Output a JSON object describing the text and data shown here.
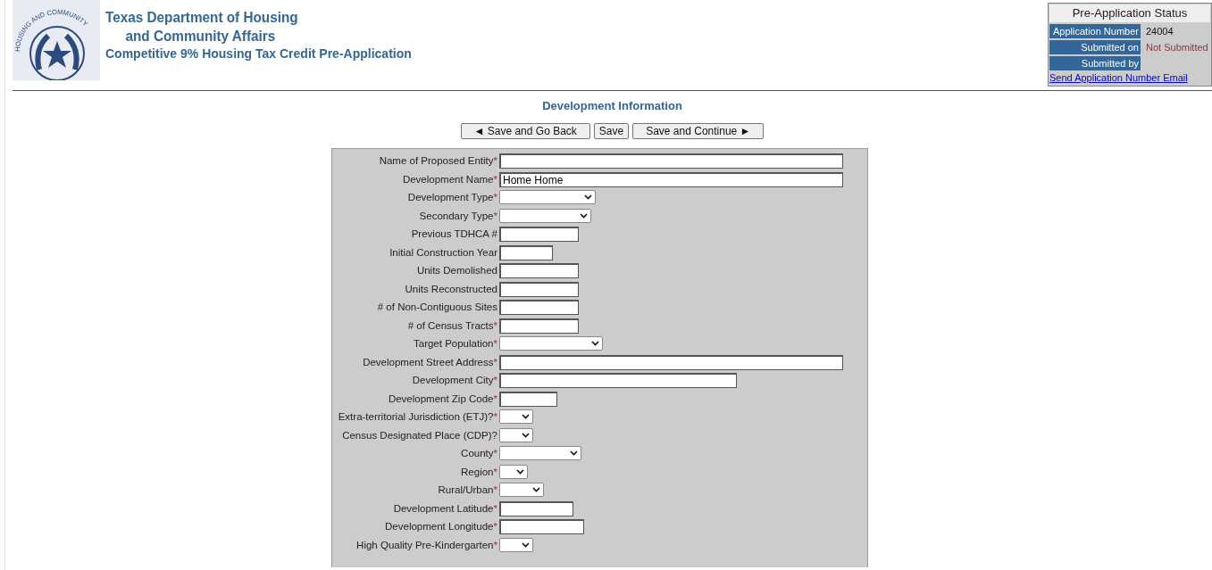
{
  "header": {
    "seal_text": "HOUSING AND COMMUNITY",
    "agency_line_1": "Texas Department of Housing",
    "agency_line_2": "and Community Affairs",
    "subtitle": "Competitive 9% Housing Tax Credit Pre-Application"
  },
  "status_panel": {
    "title": "Pre-Application Status",
    "rows": [
      {
        "label": "Application Number",
        "value": "24004",
        "kind": "plain"
      },
      {
        "label": "Submitted on",
        "value": "Not Submitted",
        "kind": "alert"
      },
      {
        "label": "Submitted by",
        "kind": "plain"
      }
    ],
    "link": "Send Application Number Email"
  },
  "section_title": "Development Information",
  "buttons": [
    {
      "label": "Save and Go Back",
      "arrow_before": "◄"
    },
    {
      "label": "Save"
    },
    {
      "label": "Save and Continue",
      "arrow_after": "►"
    }
  ],
  "fields": [
    {
      "label": "Name of Proposed Entity",
      "required": "*",
      "kind": "text"
    },
    {
      "label": "Development Name",
      "required": "*",
      "kind": "text",
      "value": "Home Home"
    },
    {
      "label": "Development Type",
      "required": "*",
      "kind": "select"
    },
    {
      "label": "Secondary Type",
      "required": "*",
      "kind": "select"
    },
    {
      "label": "Previous TDHCA #",
      "kind": "text"
    },
    {
      "label": "Initial Construction Year",
      "kind": "text"
    },
    {
      "label": "Units Demolished",
      "kind": "text"
    },
    {
      "label": "Units Reconstructed",
      "kind": "text"
    },
    {
      "label": "# of Non-Contiguous Sites",
      "kind": "text"
    },
    {
      "label": "# of Census Tracts",
      "required": "*",
      "kind": "text"
    },
    {
      "label": "Target Population",
      "required": "*",
      "kind": "select"
    },
    {
      "label": "Development Street Address",
      "required": "*",
      "kind": "text"
    },
    {
      "label": "Development City",
      "required": "*",
      "kind": "text"
    },
    {
      "label": "Development Zip Code",
      "required": "*",
      "kind": "text"
    },
    {
      "label": "Extra-territorial Jurisdiction (ETJ)?",
      "required": "*",
      "kind": "select"
    },
    {
      "label": "Census Designated Place (CDP)?",
      "kind": "select"
    },
    {
      "label": "County",
      "required": "*",
      "kind": "select"
    },
    {
      "label": "Region",
      "required": "*",
      "kind": "select"
    },
    {
      "label": "Rural/Urban",
      "required": "*",
      "kind": "select"
    },
    {
      "label": "Development Latitude",
      "required": "*",
      "kind": "text"
    },
    {
      "label": "Development Longitude",
      "required": "*",
      "kind": "text"
    },
    {
      "label": "High Quality Pre-Kindergarten",
      "required": "*",
      "kind": "select"
    }
  ]
}
